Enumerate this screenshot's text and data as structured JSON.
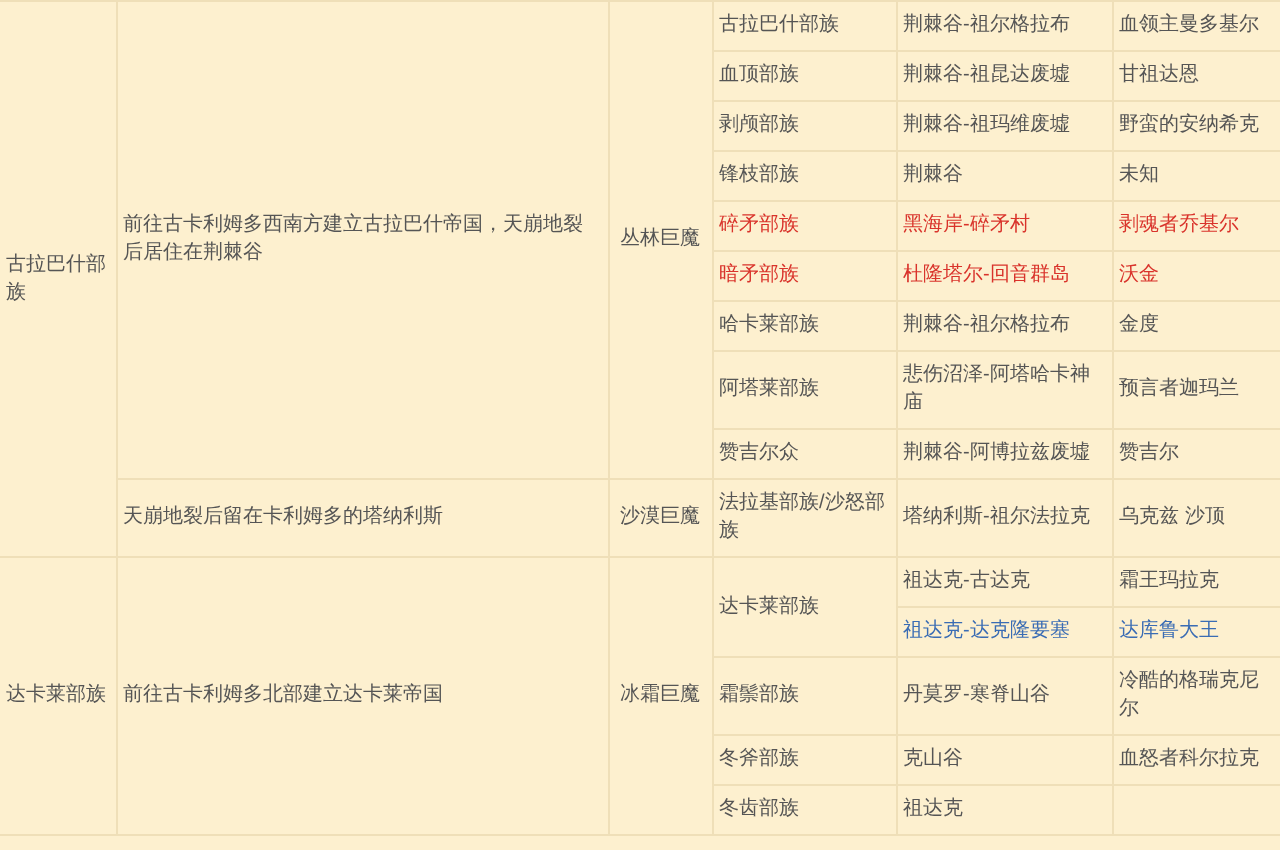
{
  "factions": [
    {
      "faction": "古拉巴什部族",
      "groups": [
        {
          "description": "前往古卡利姆多西南方建立古拉巴什帝国，天崩地裂后居住在荆棘谷",
          "troll_type": "丛林巨魔",
          "clans": [
            {
              "name": "古拉巴什部族",
              "color": "#555555",
              "locations": [
                {
                  "place": "荆棘谷-祖尔格拉布",
                  "leader": "血领主曼多基尔",
                  "color": "#555555"
                }
              ]
            },
            {
              "name": "血顶部族",
              "color": "#555555",
              "locations": [
                {
                  "place": "荆棘谷-祖昆达废墟",
                  "leader": "甘祖达恩",
                  "color": "#555555"
                }
              ]
            },
            {
              "name": "剥颅部族",
              "color": "#555555",
              "locations": [
                {
                  "place": "荆棘谷-祖玛维废墟",
                  "leader": "野蛮的安纳希克",
                  "color": "#555555"
                }
              ]
            },
            {
              "name": "锋枝部族",
              "color": "#555555",
              "locations": [
                {
                  "place": "荆棘谷",
                  "leader": "未知",
                  "color": "#555555"
                }
              ]
            },
            {
              "name": "碎矛部族",
              "color": "#d9332b",
              "locations": [
                {
                  "place": "黑海岸-碎矛村",
                  "leader": "剥魂者乔基尔",
                  "color": "#d9332b"
                }
              ]
            },
            {
              "name": "暗矛部族",
              "color": "#d9332b",
              "locations": [
                {
                  "place": "杜隆塔尔-回音群岛",
                  "leader": "沃金",
                  "color": "#d9332b"
                }
              ]
            },
            {
              "name": "哈卡莱部族",
              "color": "#555555",
              "locations": [
                {
                  "place": "荆棘谷-祖尔格拉布",
                  "leader": "金度",
                  "color": "#555555"
                }
              ]
            },
            {
              "name": "阿塔莱部族",
              "color": "#555555",
              "locations": [
                {
                  "place": "悲伤沼泽-阿塔哈卡神庙",
                  "leader": "预言者迦玛兰",
                  "color": "#555555"
                }
              ]
            },
            {
              "name": "赞吉尔众",
              "color": "#555555",
              "locations": [
                {
                  "place": "荆棘谷-阿博拉兹废墟",
                  "leader": "赞吉尔",
                  "color": "#555555"
                }
              ]
            }
          ]
        },
        {
          "description": "天崩地裂后留在卡利姆多的塔纳利斯",
          "troll_type": "沙漠巨魔",
          "clans": [
            {
              "name": "法拉基部族/沙怒部族",
              "color": "#555555",
              "locations": [
                {
                  "place": "塔纳利斯-祖尔法拉克",
                  "leader": "乌克兹 沙顶",
                  "color": "#555555"
                }
              ]
            }
          ]
        }
      ]
    },
    {
      "faction": "达卡莱部族",
      "groups": [
        {
          "description": "前往古卡利姆多北部建立达卡莱帝国",
          "troll_type": "冰霜巨魔",
          "clans": [
            {
              "name": "达卡莱部族",
              "color": "#555555",
              "locations": [
                {
                  "place": "祖达克-古达克",
                  "leader": "霜王玛拉克",
                  "color": "#555555"
                },
                {
                  "place": "祖达克-达克隆要塞",
                  "leader": "达库鲁大王",
                  "color": "#3a6cb4"
                }
              ]
            },
            {
              "name": "霜鬃部族",
              "color": "#555555",
              "locations": [
                {
                  "place": "丹莫罗-寒脊山谷",
                  "leader": "冷酷的格瑞克尼尔",
                  "color": "#555555"
                }
              ]
            },
            {
              "name": "冬斧部族",
              "color": "#555555",
              "locations": [
                {
                  "place": "克山谷",
                  "leader": "血怒者科尔拉克",
                  "color": "#555555"
                }
              ]
            },
            {
              "name": "冬齿部族",
              "color": "#555555",
              "locations": [
                {
                  "place": "祖达克",
                  "color": "#555555"
                }
              ]
            }
          ]
        }
      ]
    }
  ]
}
